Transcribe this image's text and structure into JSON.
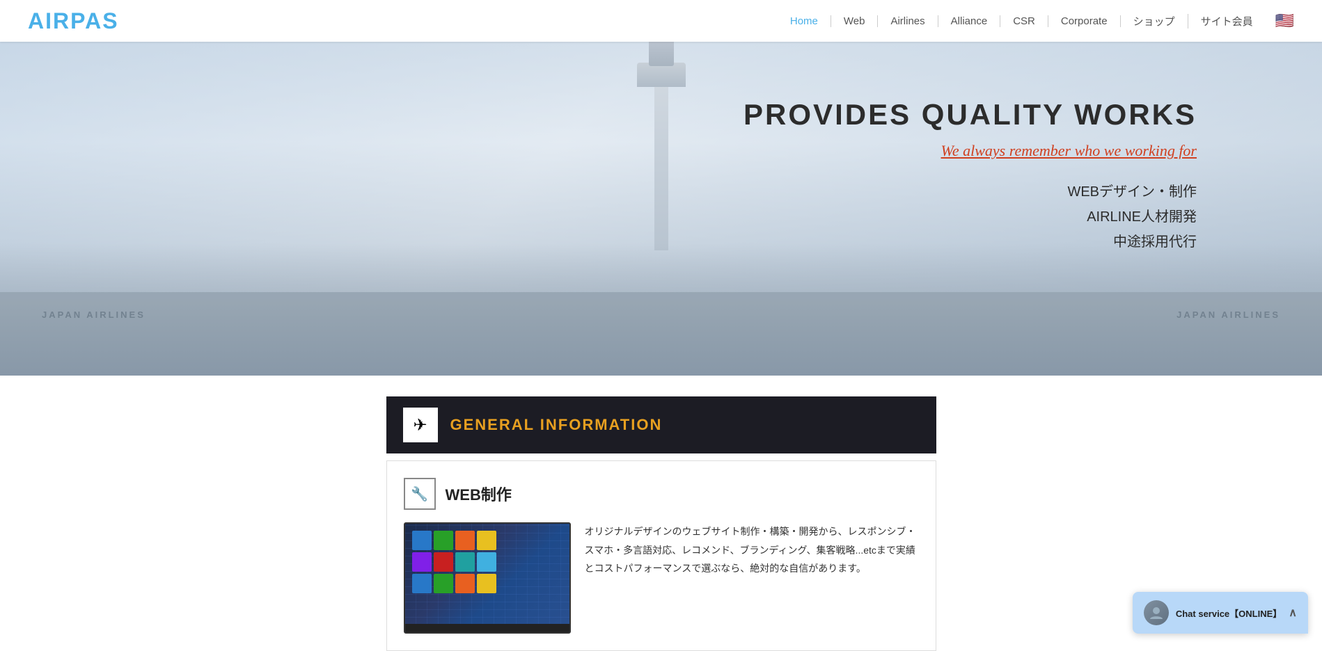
{
  "header": {
    "logo": "AIRPAS",
    "nav": [
      {
        "label": "Home",
        "active": true
      },
      {
        "label": "Web",
        "active": false
      },
      {
        "label": "Airlines",
        "active": false
      },
      {
        "label": "Alliance",
        "active": false
      },
      {
        "label": "CSR",
        "active": false
      },
      {
        "label": "Corporate",
        "active": false
      },
      {
        "label": "ショップ",
        "active": false
      },
      {
        "label": "サイト会員",
        "active": false
      }
    ],
    "flag": "🇺🇸"
  },
  "hero": {
    "title": "PROVIDES QUALITY WORKS",
    "subtitle": "We always remember who we working for",
    "services": [
      "WEBデザイン・制作",
      "AIRLINE人材開発",
      "中途採用代行"
    ],
    "airline_text_left": "JAPAN AIRLINES",
    "airline_text_right": "JAPAN AIRLINES"
  },
  "general_info": {
    "title": "GENERAL INFORMATION",
    "icon": "✈"
  },
  "web_section": {
    "title": "WEB制作",
    "icon": "🔧",
    "description": "オリジナルデザインのウェブサイト制作・構築・開発から、レスポンシブ・スマホ・多言語対応、レコメンド、ブランディング、集客戦略...etcまで実績とコストパフォーマンスで選ぶなら、絶対的な自信があります。"
  },
  "chat": {
    "label": "Chat service【ONLINE】"
  }
}
